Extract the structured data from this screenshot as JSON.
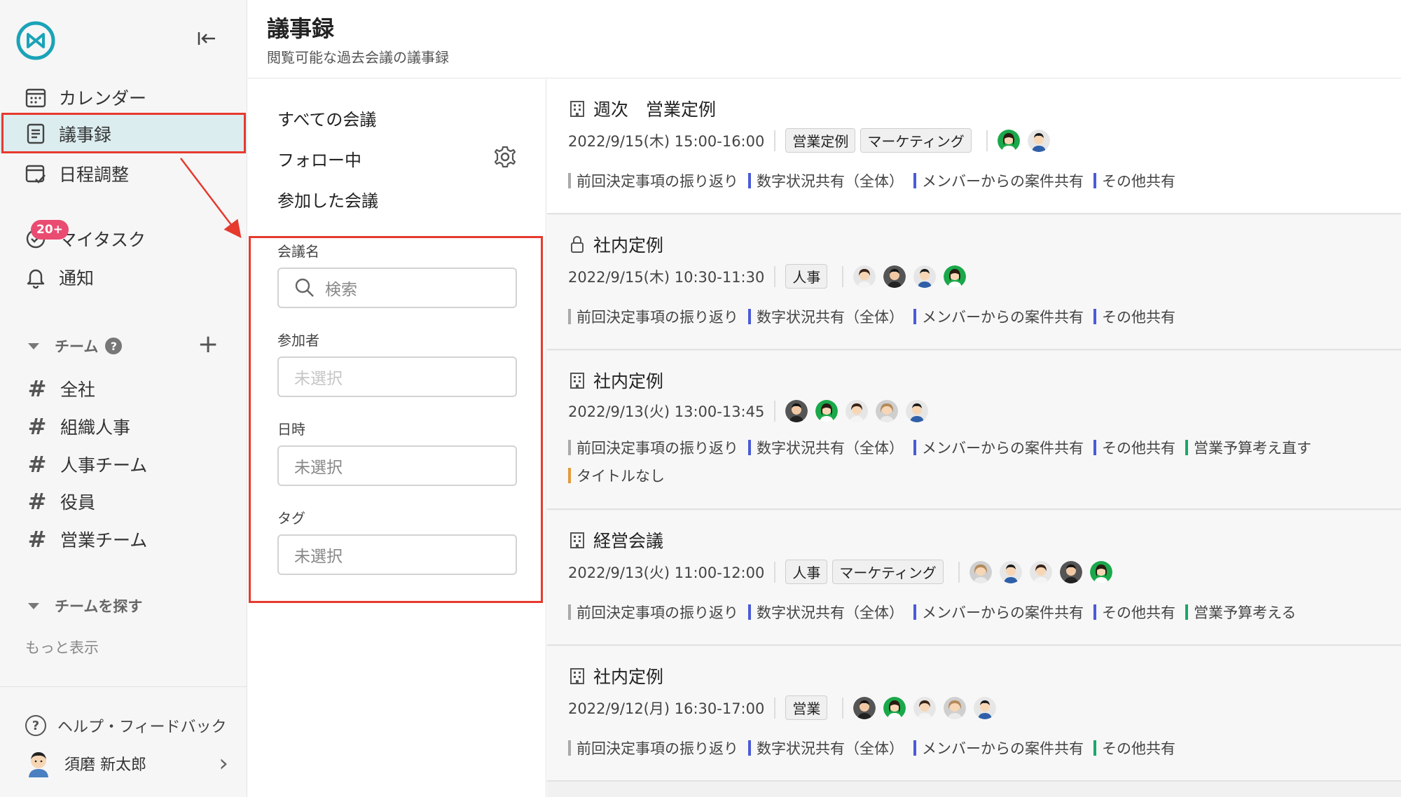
{
  "header": {
    "title": "議事録",
    "subtitle": "閲覧可能な過去会議の議事録"
  },
  "sidebar": {
    "nav": [
      {
        "label": "カレンダー",
        "icon": "calendar-icon"
      },
      {
        "label": "議事録",
        "icon": "document-icon",
        "active": true
      },
      {
        "label": "日程調整",
        "icon": "schedule-icon"
      },
      {
        "label": "マイタスク",
        "icon": "task-icon",
        "badge": "20+"
      },
      {
        "label": "通知",
        "icon": "bell-icon"
      }
    ],
    "teams_heading": "チーム",
    "teams": [
      "全社",
      "組織人事",
      "人事チーム",
      "役員",
      "営業チーム"
    ],
    "find_teams": "チームを探す",
    "more": "もっと表示",
    "help": "ヘルプ・フィードバック",
    "user": "須磨 新太郎"
  },
  "filters": {
    "links": [
      "すべての会議",
      "フォロー中",
      "参加した会議"
    ],
    "meeting_name_label": "会議名",
    "search_placeholder": "検索",
    "participants_label": "参加者",
    "participants_value": "未選択",
    "datetime_label": "日時",
    "datetime_value": "未選択",
    "tag_label": "タグ",
    "tag_value": "未選択"
  },
  "meetings": [
    {
      "title": "週次　営業定例",
      "icon": "building-icon",
      "datetime": "2022/9/15(木) 15:00-16:00",
      "tags": [
        "営業定例",
        "マーケティング"
      ],
      "agenda": [
        {
          "text": "前回決定事項の振り返り",
          "color": "#aaaaaa"
        },
        {
          "text": "数字状況共有（全体）",
          "color": "#4a5bd8"
        },
        {
          "text": "メンバーからの案件共有",
          "color": "#4a5bd8"
        },
        {
          "text": "その他共有",
          "color": "#4a5bd8"
        }
      ]
    },
    {
      "title": "社内定例",
      "icon": "lock-icon",
      "datetime": "2022/9/15(木) 10:30-11:30",
      "tags": [
        "人事"
      ],
      "agenda": [
        {
          "text": "前回決定事項の振り返り",
          "color": "#aaaaaa"
        },
        {
          "text": "数字状況共有（全体）",
          "color": "#4a5bd8"
        },
        {
          "text": "メンバーからの案件共有",
          "color": "#4a5bd8"
        },
        {
          "text": "その他共有",
          "color": "#4a5bd8"
        }
      ]
    },
    {
      "title": "社内定例",
      "icon": "building-icon",
      "datetime": "2022/9/13(火) 13:00-13:45",
      "tags": [],
      "agenda": [
        {
          "text": "前回決定事項の振り返り",
          "color": "#aaaaaa"
        },
        {
          "text": "数字状況共有（全体）",
          "color": "#4a5bd8"
        },
        {
          "text": "メンバーからの案件共有",
          "color": "#4a5bd8"
        },
        {
          "text": "その他共有",
          "color": "#4a5bd8"
        },
        {
          "text": "営業予算考え直す",
          "color": "#1aa866"
        },
        {
          "text": "タイトルなし",
          "color": "#e39a3c"
        }
      ]
    },
    {
      "title": "経営会議",
      "icon": "building-icon",
      "datetime": "2022/9/13(火) 11:00-12:00",
      "tags": [
        "人事",
        "マーケティング"
      ],
      "agenda": [
        {
          "text": "前回決定事項の振り返り",
          "color": "#aaaaaa"
        },
        {
          "text": "数字状況共有（全体）",
          "color": "#4a5bd8"
        },
        {
          "text": "メンバーからの案件共有",
          "color": "#4a5bd8"
        },
        {
          "text": "その他共有",
          "color": "#4a5bd8"
        },
        {
          "text": "営業予算考える",
          "color": "#1aa866"
        }
      ]
    },
    {
      "title": "社内定例",
      "icon": "building-icon",
      "datetime": "2022/9/12(月) 16:30-17:00",
      "tags": [
        "営業"
      ],
      "agenda": [
        {
          "text": "前回決定事項の振り返り",
          "color": "#aaaaaa"
        },
        {
          "text": "数字状況共有（全体）",
          "color": "#4a5bd8"
        },
        {
          "text": "メンバーからの案件共有",
          "color": "#4a5bd8"
        },
        {
          "text": "その他共有",
          "color": "#1aa866"
        }
      ]
    }
  ],
  "colors": {
    "accent": "#1aa3b8",
    "annotation": "#e63a2e",
    "active_bg": "#dcedf0"
  }
}
